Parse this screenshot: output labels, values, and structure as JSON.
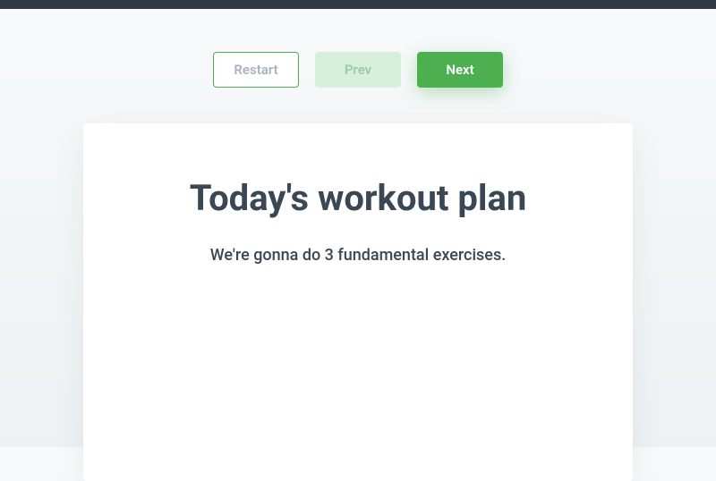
{
  "buttons": {
    "restart": "Restart",
    "prev": "Prev",
    "next": "Next"
  },
  "card": {
    "title": "Today's workout plan",
    "subtitle": "We're gonna do 3 fundamental exercises."
  }
}
